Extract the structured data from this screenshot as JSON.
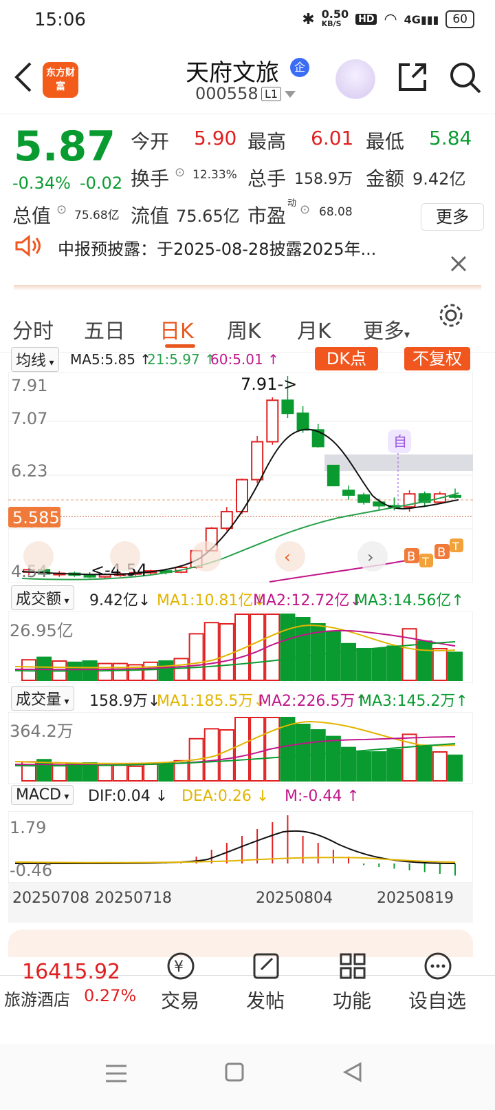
{
  "status": {
    "time": "15:06",
    "net_speed": "0.50",
    "net_unit": "KB/S",
    "hd": "HD",
    "sig": "4G",
    "battery": "60"
  },
  "header": {
    "logo": "东方财富",
    "name": "天府文旅",
    "name_badge": "企",
    "code": "000558",
    "level": "L1"
  },
  "quote": {
    "price": "5.87",
    "change_pct": "-0.34%",
    "change": "-0.02",
    "open_label": "今开",
    "open": "5.90",
    "high_label": "最高",
    "high": "6.01",
    "low_label": "最低",
    "low": "5.84",
    "turnover_rate_label": "换手",
    "turnover_rate": "12.33%",
    "volume_label": "总手",
    "volume": "158.9万",
    "amount_label": "金额",
    "amount": "9.42亿",
    "mktcap_label": "总值",
    "mktcap": "75.68亿",
    "float_label": "流值",
    "float": "75.65亿",
    "pe_label": "市盈",
    "pe_sup": "动",
    "pe": "68.08",
    "more": "更多"
  },
  "notice": {
    "text": "中报预披露：于2025-08-28披露2025年..."
  },
  "tabs": [
    "分时",
    "五日",
    "日K",
    "周K",
    "月K",
    "更多"
  ],
  "ma_bar": {
    "mode": "均线",
    "ma5": "MA5:5.85",
    "ma21": "21:5.97",
    "ma60": "60:5.01",
    "dk": "DK点",
    "fq": "不复权"
  },
  "kline": {
    "y_max": "7.91",
    "y2": "7.07",
    "y3": "6.23",
    "y4": "5.38",
    "y_min": "4.54",
    "current": "5.585",
    "hi_label": "7.91->",
    "lo_label": "<-4.54",
    "marker": "自",
    "b": "B",
    "t": "T"
  },
  "amount_bar": {
    "label": "成交额",
    "value": "9.42亿",
    "ma1": "MA1:10.81亿",
    "ma2": "MA2:12.72亿",
    "ma3": "MA3:14.56亿",
    "axis": "26.95亿"
  },
  "volume_bar": {
    "label": "成交量",
    "value": "158.9万",
    "ma1": "MA1:185.5万",
    "ma2": "MA2:226.5万",
    "ma3": "MA3:145.2万",
    "axis": "364.2万"
  },
  "macd_bar": {
    "label": "MACD",
    "dif": "DIF:0.04",
    "dea": "DEA:0.26",
    "m": "M:-0.44",
    "axis_top": "1.79",
    "axis_bottom": "-0.46"
  },
  "dates": [
    "20250708",
    "20250718",
    "20250804",
    "20250819"
  ],
  "bottom": {
    "index_value": "16415.92",
    "sector": "旅游酒店",
    "sector_change": "0.27%",
    "trade": "交易",
    "post": "发帖",
    "func": "功能",
    "watch": "设自选"
  },
  "colors": {
    "up": "#e02020",
    "down": "#0a9b30",
    "accent": "#f0561e"
  },
  "chart_data": {
    "type": "candlestick",
    "ylim": [
      4.54,
      7.91
    ],
    "candles": [
      [
        4.6,
        4.66,
        4.55,
        4.64
      ],
      [
        4.64,
        4.68,
        4.55,
        4.57
      ],
      [
        4.57,
        4.62,
        4.52,
        4.58
      ],
      [
        4.58,
        4.61,
        4.52,
        4.55
      ],
      [
        4.55,
        4.6,
        4.5,
        4.52
      ],
      [
        4.52,
        4.58,
        4.5,
        4.56
      ],
      [
        4.56,
        4.6,
        4.52,
        4.57
      ],
      [
        4.57,
        4.61,
        4.54,
        4.59
      ],
      [
        4.59,
        4.64,
        4.55,
        4.62
      ],
      [
        4.62,
        4.66,
        4.56,
        4.6
      ],
      [
        4.6,
        4.7,
        4.58,
        4.68
      ],
      [
        4.68,
        4.98,
        4.66,
        4.96
      ],
      [
        4.96,
        5.36,
        4.95,
        5.34
      ],
      [
        5.34,
        5.7,
        5.3,
        5.62
      ],
      [
        5.62,
        6.18,
        5.58,
        6.16
      ],
      [
        6.16,
        6.9,
        6.1,
        6.8
      ],
      [
        6.8,
        7.55,
        6.75,
        7.5
      ],
      [
        7.5,
        7.91,
        7.2,
        7.28
      ],
      [
        7.28,
        7.4,
        6.95,
        7.0
      ],
      [
        7.0,
        7.1,
        6.7,
        6.72
      ],
      [
        6.4,
        6.4,
        6.06,
        6.06
      ],
      [
        5.98,
        6.06,
        5.82,
        5.9
      ],
      [
        5.9,
        5.94,
        5.74,
        5.78
      ],
      [
        5.78,
        5.84,
        5.64,
        5.72
      ],
      [
        5.72,
        5.86,
        5.64,
        5.7
      ],
      [
        5.7,
        5.98,
        5.62,
        5.92
      ],
      [
        5.92,
        5.96,
        5.7,
        5.78
      ],
      [
        5.78,
        5.96,
        5.76,
        5.92
      ],
      [
        5.89,
        6.01,
        5.84,
        5.87
      ]
    ]
  }
}
